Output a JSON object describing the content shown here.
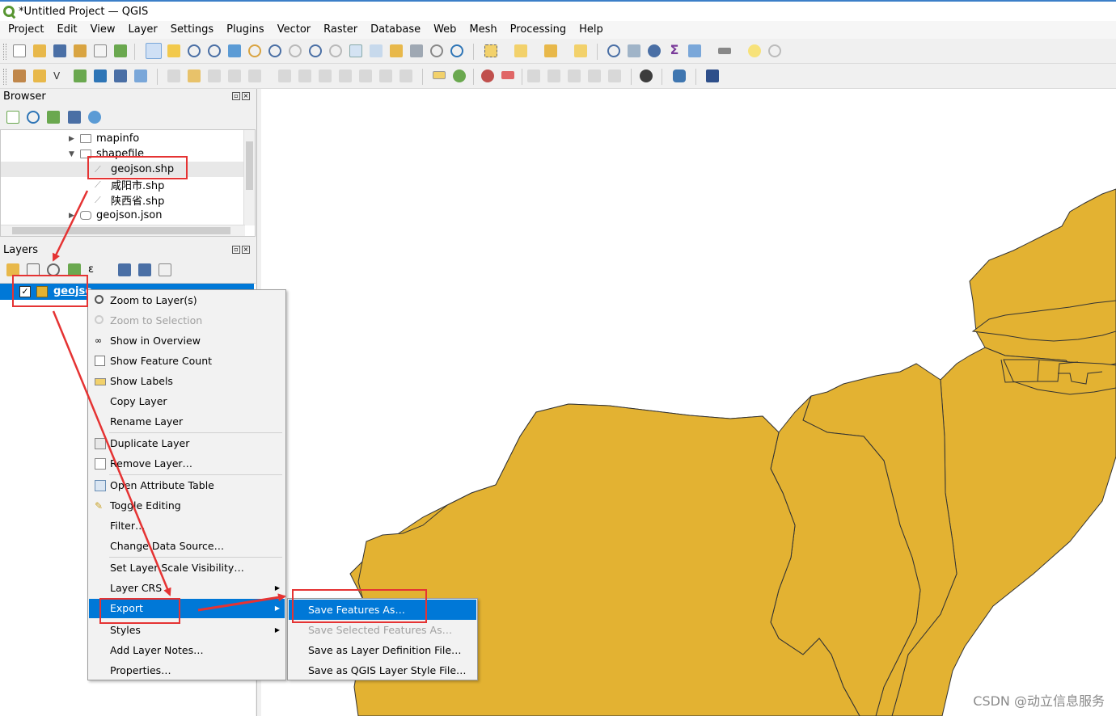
{
  "window": {
    "title": "*Untitled Project — QGIS"
  },
  "menubar": [
    "Project",
    "Edit",
    "View",
    "Layer",
    "Settings",
    "Plugins",
    "Vector",
    "Raster",
    "Database",
    "Web",
    "Mesh",
    "Processing",
    "Help"
  ],
  "browser": {
    "title": "Browser",
    "items": [
      "mapinfo",
      "shapefile",
      "geojson.shp",
      "咸阳市.shp",
      "陕西省.shp",
      "geojson.json"
    ]
  },
  "layers": {
    "title": "Layers",
    "layer_name": "geojso"
  },
  "context_menu": {
    "items": [
      "Zoom to Layer(s)",
      "Zoom to Selection",
      "Show in Overview",
      "Show Feature Count",
      "Show Labels",
      "Copy Layer",
      "Rename Layer",
      "Duplicate Layer",
      "Remove Layer…",
      "Open Attribute Table",
      "Toggle Editing",
      "Filter…",
      "Change Data Source…",
      "Set Layer Scale Visibility…",
      "Layer CRS",
      "Export",
      "Styles",
      "Add Layer Notes…",
      "Properties…"
    ]
  },
  "export_submenu": {
    "items": [
      "Save Features As…",
      "Save Selected Features As…",
      "Save as Layer Definition File…",
      "Save as QGIS Layer Style File…"
    ]
  },
  "colors": {
    "polygon_fill": "#e3b232",
    "highlight_red": "#e53333",
    "selection_blue": "#0078d7"
  },
  "watermark": "CSDN @动立信息服务"
}
